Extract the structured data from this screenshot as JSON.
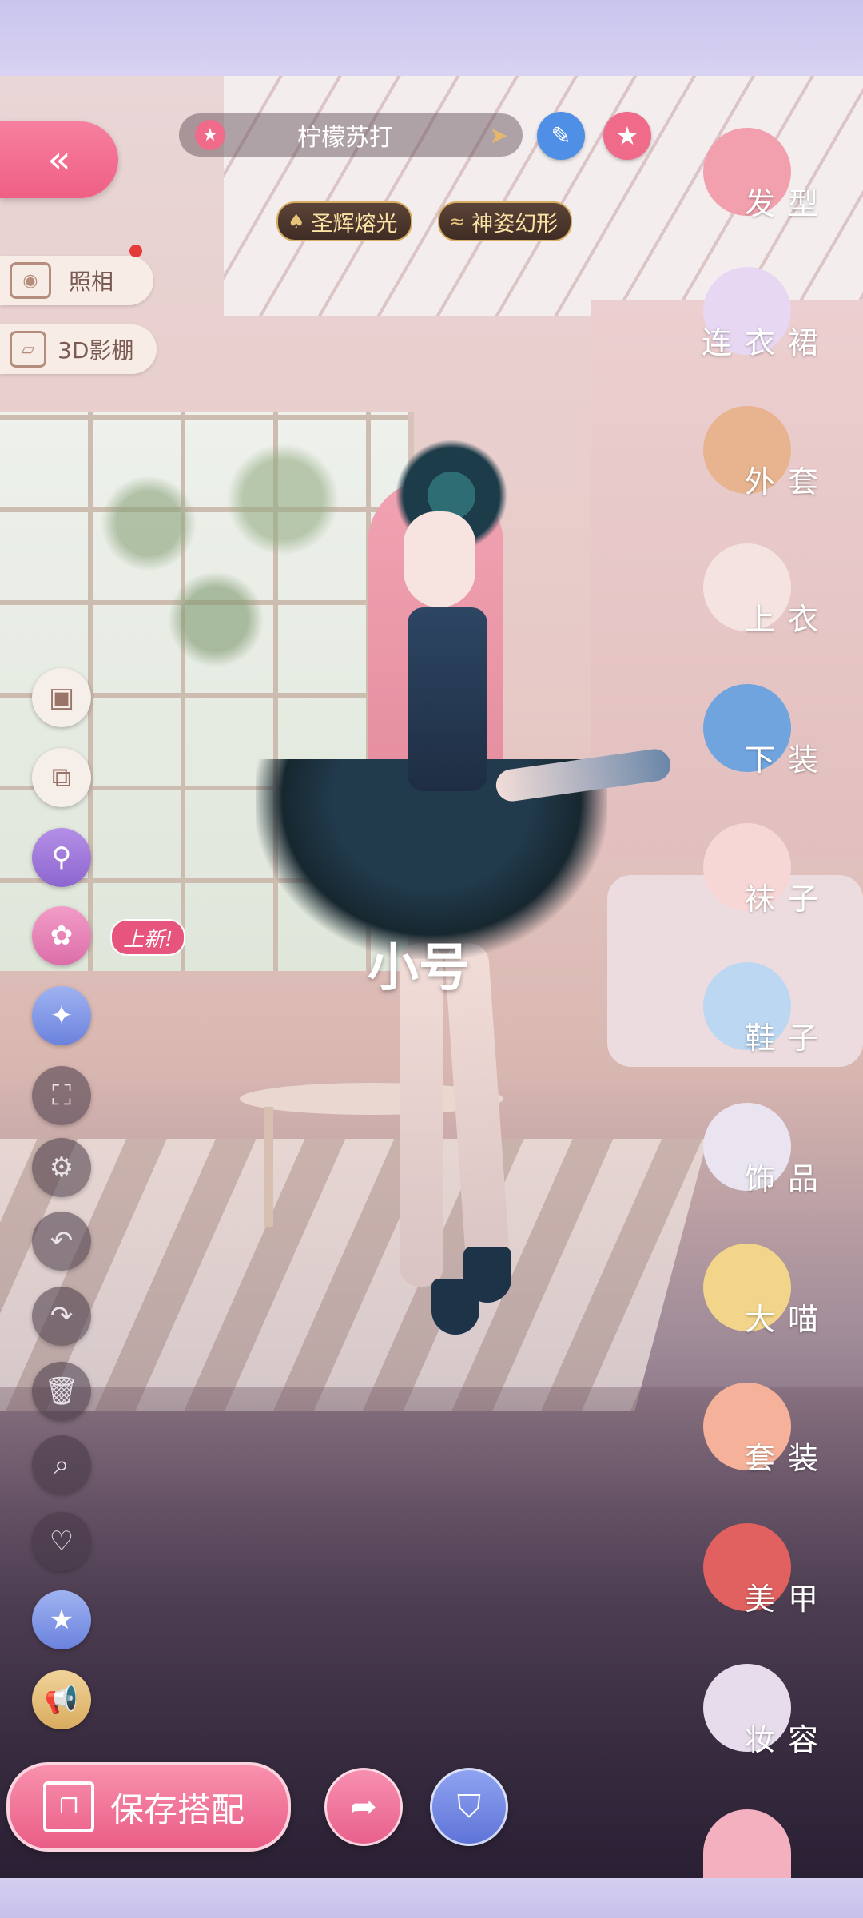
{
  "header": {
    "outfit_name": "柠檬苏打",
    "back_icon": "double-chevron-left-icon",
    "edit_icon": "pencil-icon",
    "favorite_icon": "star-icon",
    "star_icon": "star-icon",
    "badges": [
      {
        "label": "圣辉熔光",
        "icon": "flame-crest-icon"
      },
      {
        "label": "神姿幻形",
        "icon": "wing-crest-icon"
      }
    ]
  },
  "left_actions": {
    "photo_label": "照相",
    "studio_label": "3D影棚"
  },
  "tools": [
    {
      "name": "pose-tool",
      "icon": "phone-frame-icon",
      "glyph": "▣"
    },
    {
      "name": "layer-tool",
      "icon": "layers-icon",
      "glyph": "⧉"
    },
    {
      "name": "inspect-tool",
      "icon": "magnify-swap-icon",
      "glyph": "⚲"
    },
    {
      "name": "palette-tool",
      "icon": "palette-icon",
      "glyph": "🎨"
    },
    {
      "name": "effect-tool",
      "icon": "sparkle-star-icon",
      "glyph": "✦"
    },
    {
      "name": "fullscreen-tool",
      "icon": "expand-icon",
      "glyph": "⛶"
    },
    {
      "name": "settings-tool",
      "icon": "gear-icon",
      "glyph": "⚙"
    },
    {
      "name": "undo-tool",
      "icon": "undo-icon",
      "glyph": "↶"
    },
    {
      "name": "redo-tool",
      "icon": "redo-icon",
      "glyph": "↷"
    },
    {
      "name": "delete-tool",
      "icon": "trash-icon",
      "glyph": "🗑"
    },
    {
      "name": "search-tool",
      "icon": "search-icon",
      "glyph": "⌕"
    },
    {
      "name": "favorite-tool",
      "icon": "heart-icon",
      "glyph": "♡"
    },
    {
      "name": "collection-tool",
      "icon": "star-badge-icon",
      "glyph": "★"
    },
    {
      "name": "announce-tool",
      "icon": "megaphone-icon",
      "glyph": "📢"
    }
  ],
  "new_tag": "上新!",
  "watermark": "小号",
  "categories": [
    {
      "label": "发型",
      "icon": "hairstyle-icon",
      "color": "#f2a0ad"
    },
    {
      "label": "连衣裙",
      "icon": "dress-icon",
      "color": "#e8d7f3"
    },
    {
      "label": "外套",
      "icon": "coat-icon",
      "color": "#e8b48f"
    },
    {
      "label": "上衣",
      "icon": "blouse-icon",
      "color": "#f5e3e1"
    },
    {
      "label": "下装",
      "icon": "shorts-icon",
      "color": "#6fa4de"
    },
    {
      "label": "袜子",
      "icon": "socks-icon",
      "color": "#f7d6d6"
    },
    {
      "label": "鞋子",
      "icon": "shoe-icon",
      "color": "#bcd7f2"
    },
    {
      "label": "饰品",
      "icon": "tiara-icon",
      "color": "#e9e4f0"
    },
    {
      "label": "大喵",
      "icon": "cat-icon",
      "color": "#f2d58a"
    },
    {
      "label": "套装",
      "icon": "outfit-set-icon",
      "color": "#f5b19a"
    },
    {
      "label": "美甲",
      "icon": "nail-polish-icon",
      "color": "#e0615f"
    },
    {
      "label": "妆容",
      "icon": "makeup-icon",
      "color": "#e6dcec"
    },
    {
      "label": "",
      "icon": "character-icon",
      "color": "#f3b0be"
    }
  ],
  "bottom": {
    "save_label": "保存搭配",
    "save_icon": "save-outfit-icon",
    "share_icon": "share-arrow-icon",
    "wardrobe_icon": "wardrobe-icon"
  }
}
